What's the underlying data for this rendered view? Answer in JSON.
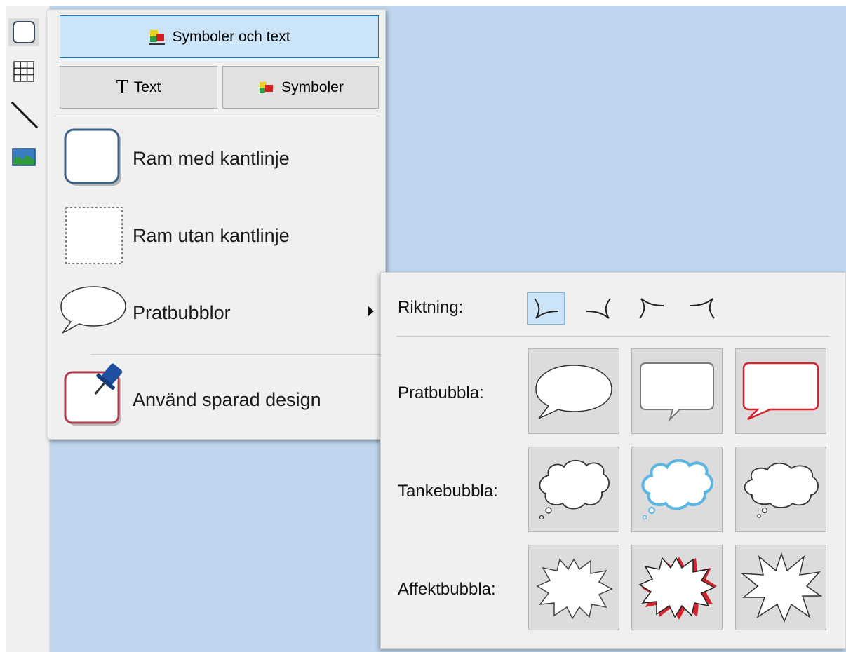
{
  "main_menu": {
    "symbols_and_text_label": "Symboler och text",
    "text_label": "Text",
    "symbols_label": "Symboler",
    "frame_with_border": "Ram med kantlinje",
    "frame_without_border": "Ram utan kantlinje",
    "speech_bubbles": "Pratbubblor",
    "use_saved_design": "Använd sparad design"
  },
  "bubble_submenu": {
    "direction_label": "Riktning:",
    "speech_label": "Pratbubbla:",
    "thought_label": "Tankebubbla:",
    "affect_label": "Affektbubbla:"
  },
  "toolbar": {
    "tools": [
      "frame-icon",
      "table-icon",
      "line-icon",
      "image-icon"
    ]
  },
  "colors": {
    "canvas": "#bfd6ee",
    "accent": "#0078d7",
    "selected_fill": "#cce4f7",
    "red_bubble": "#d2242f",
    "blue_bubble": "#5bb6e2"
  }
}
